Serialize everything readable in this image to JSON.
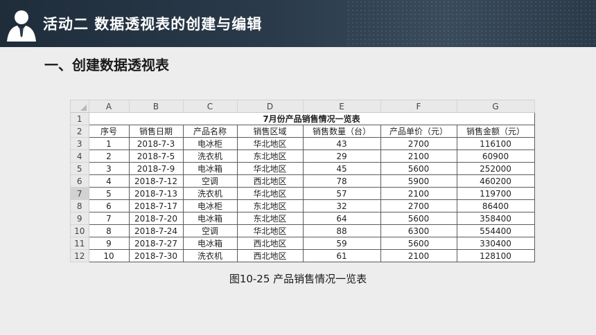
{
  "header": {
    "title": "活动二   数据透视表的创建与编辑"
  },
  "section_title": "一、创建数据透视表",
  "spreadsheet": {
    "columns": [
      "A",
      "B",
      "C",
      "D",
      "E",
      "F",
      "G"
    ],
    "row_numbers": [
      "1",
      "2",
      "3",
      "4",
      "5",
      "6",
      "7",
      "8",
      "9",
      "10",
      "11",
      "12"
    ],
    "title": "7月份产品销售情况一览表",
    "headers": [
      "序号",
      "销售日期",
      "产品名称",
      "销售区域",
      "销售数量（台）",
      "产品单价（元）",
      "销售金额（元）"
    ],
    "rows": [
      [
        "1",
        "2018-7-3",
        "电冰柜",
        "华北地区",
        "43",
        "2700",
        "116100"
      ],
      [
        "2",
        "2018-7-5",
        "洗衣机",
        "东北地区",
        "29",
        "2100",
        "60900"
      ],
      [
        "3",
        "2018-7-9",
        "电冰箱",
        "华北地区",
        "45",
        "5600",
        "252000"
      ],
      [
        "4",
        "2018-7-12",
        "空调",
        "西北地区",
        "78",
        "5900",
        "460200"
      ],
      [
        "5",
        "2018-7-13",
        "洗衣机",
        "华北地区",
        "57",
        "2100",
        "119700"
      ],
      [
        "6",
        "2018-7-17",
        "电冰柜",
        "东北地区",
        "32",
        "2700",
        "86400"
      ],
      [
        "7",
        "2018-7-20",
        "电冰箱",
        "东北地区",
        "64",
        "5600",
        "358400"
      ],
      [
        "8",
        "2018-7-24",
        "空调",
        "华北地区",
        "88",
        "6300",
        "554400"
      ],
      [
        "9",
        "2018-7-27",
        "电冰箱",
        "西北地区",
        "59",
        "5600",
        "330400"
      ],
      [
        "10",
        "2018-7-30",
        "洗衣机",
        "西北地区",
        "61",
        "2100",
        "128100"
      ]
    ]
  },
  "caption": "图10-25  产品销售情况一览表"
}
